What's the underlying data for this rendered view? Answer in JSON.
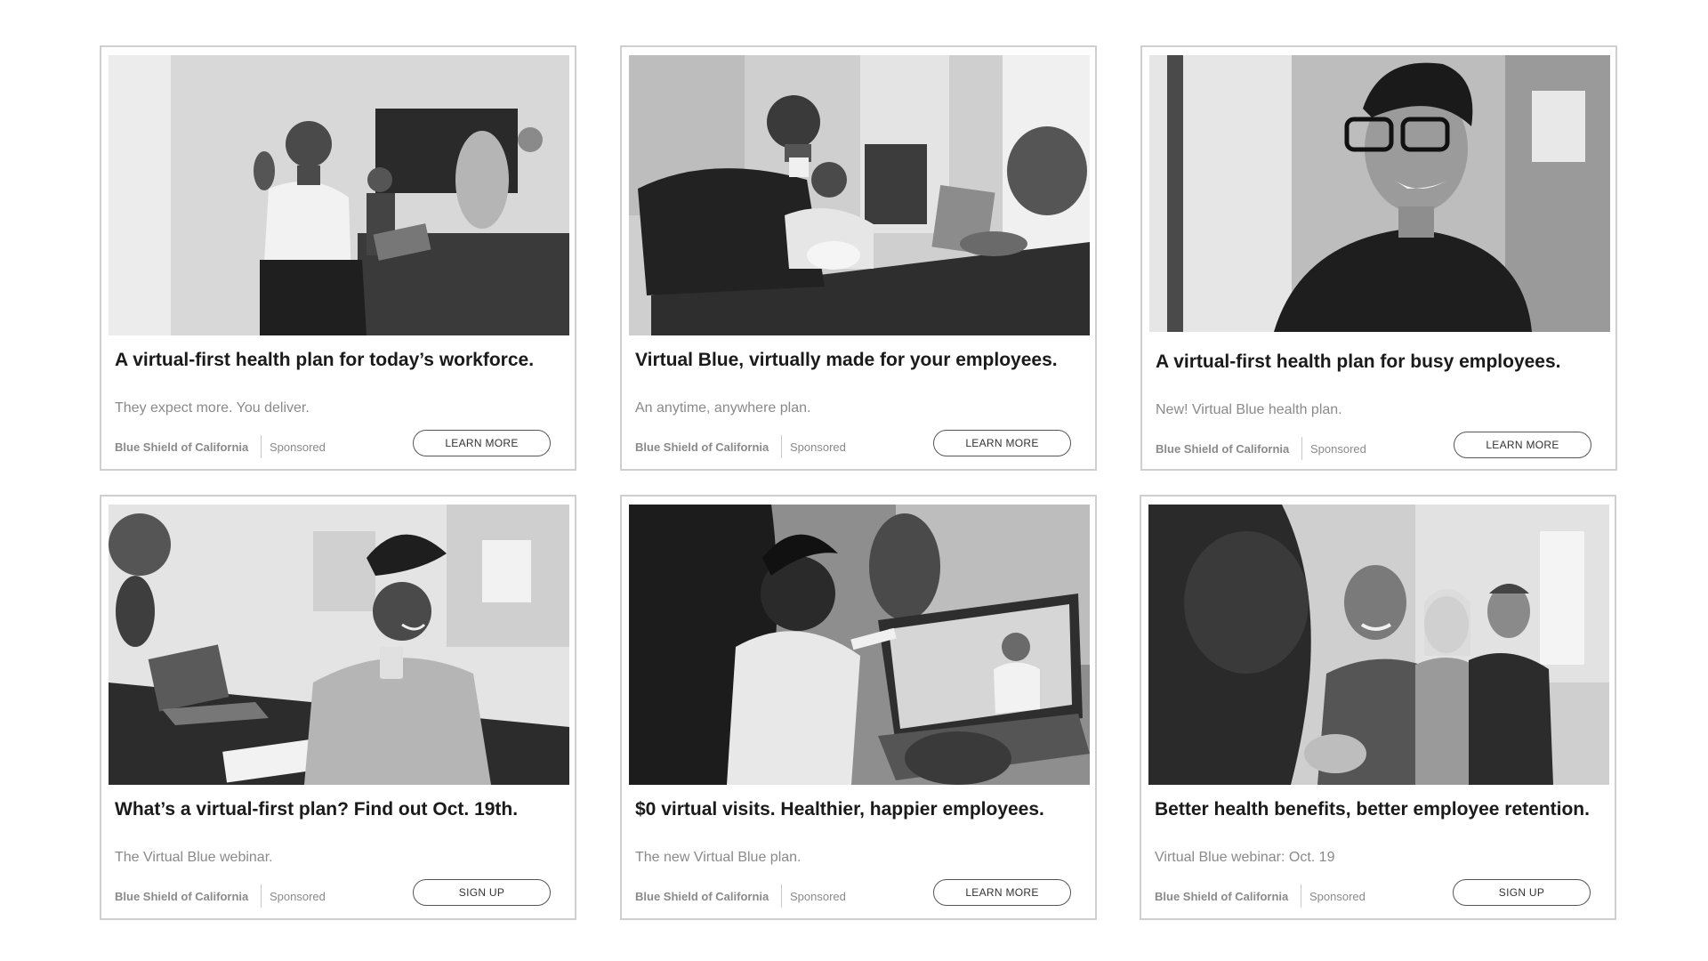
{
  "cards": [
    {
      "headline": "A virtual-first health plan for today’s workforce.",
      "subtext": "They expect more. You deliver.",
      "brand": "Blue Shield of California",
      "sponsored": "Sponsored",
      "cta": "LEARN MORE"
    },
    {
      "headline": "Virtual Blue, virtually made for your employees.",
      "subtext": "An anytime, anywhere plan.",
      "brand": "Blue Shield of California",
      "sponsored": "Sponsored",
      "cta": "LEARN MORE"
    },
    {
      "headline": "A virtual-first health plan for busy employees.",
      "subtext": "New! Virtual Blue health plan.",
      "brand": "Blue Shield of California",
      "sponsored": "Sponsored",
      "cta": "LEARN MORE"
    },
    {
      "headline": "What’s a virtual-first plan? Find out Oct. 19th.",
      "subtext": "The Virtual Blue webinar.",
      "brand": "Blue Shield of California",
      "sponsored": "Sponsored",
      "cta": "SIGN UP"
    },
    {
      "headline": "$0 virtual visits. Healthier, happier employees.",
      "subtext": "The new Virtual Blue plan.",
      "brand": "Blue Shield of California",
      "sponsored": "Sponsored",
      "cta": "LEARN MORE"
    },
    {
      "headline": "Better health benefits, better employee retention.",
      "subtext": "Virtual Blue webinar: Oct. 19",
      "brand": "Blue Shield of California",
      "sponsored": "Sponsored",
      "cta": "SIGN UP"
    }
  ]
}
